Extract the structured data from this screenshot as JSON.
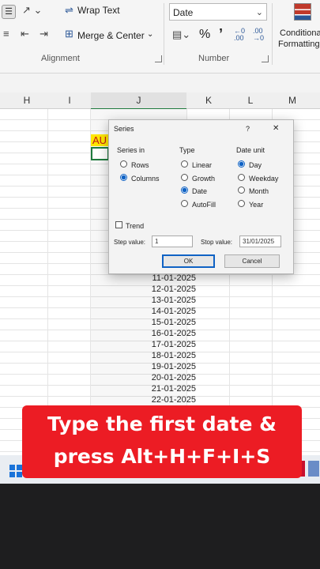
{
  "ribbon": {
    "wrap_text": "Wrap Text",
    "merge_center": "Merge & Center",
    "alignment_label": "Alignment",
    "number_format": "Date",
    "percent": "%",
    "comma": "’",
    "inc_decimal": "←.0\n.00",
    "dec_decimal": ".00\n→.0",
    "number_label": "Number",
    "conditional_formatting_1": "Conditiona",
    "conditional_formatting_2": "Formatting"
  },
  "columns": [
    "H",
    "I",
    "J",
    "K",
    "L",
    "M"
  ],
  "cells": {
    "j_top": "AU"
  },
  "dates": [
    "11-01-2025",
    "12-01-2025",
    "13-01-2025",
    "14-01-2025",
    "15-01-2025",
    "16-01-2025",
    "17-01-2025",
    "18-01-2025",
    "19-01-2025",
    "20-01-2025",
    "21-01-2025",
    "22-01-2025"
  ],
  "dialog": {
    "title": "Series",
    "help": "?",
    "close": "✕",
    "series_in_label": "Series in",
    "rows": "Rows",
    "columns": "Columns",
    "type_label": "Type",
    "linear": "Linear",
    "growth": "Growth",
    "date": "Date",
    "autofill": "AutoFill",
    "date_unit_label": "Date unit",
    "day": "Day",
    "weekday": "Weekday",
    "month": "Month",
    "year": "Year",
    "trend": "Trend",
    "step_value_label": "Step value:",
    "step_value": "1",
    "stop_value_label": "Stop value:",
    "stop_value": "31/01/2025",
    "ok": "OK",
    "cancel": "Cancel"
  },
  "caption": {
    "line1": "Type the first date &",
    "line2": "press Alt+H+F+I+S"
  },
  "colors": {
    "caption_bg": "#ec1c24",
    "accent": "#0f62c4",
    "selection": "#1f7a3e",
    "highlight": "#ffe600"
  }
}
